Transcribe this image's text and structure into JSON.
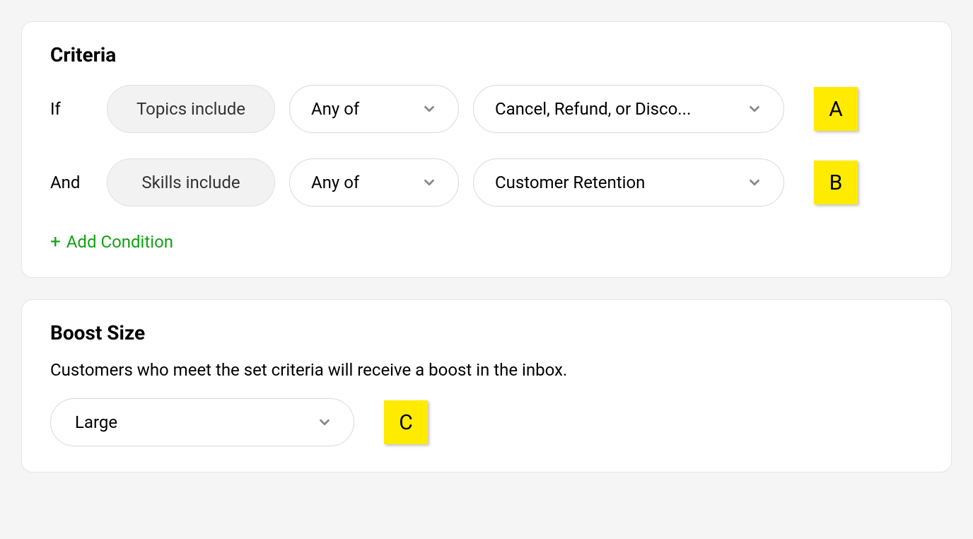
{
  "criteria": {
    "title": "Criteria",
    "rows": [
      {
        "label": "If",
        "field": "Topics include",
        "operator": "Any of",
        "value": "Cancel, Refund, or Disco...",
        "marker": "A"
      },
      {
        "label": "And",
        "field": "Skills include",
        "operator": "Any of",
        "value": "Customer Retention",
        "marker": "B"
      }
    ],
    "add_condition_label": "Add Condition"
  },
  "boost": {
    "title": "Boost Size",
    "description": "Customers who meet the set criteria will receive a boost in the inbox.",
    "value": "Large",
    "marker": "C"
  }
}
